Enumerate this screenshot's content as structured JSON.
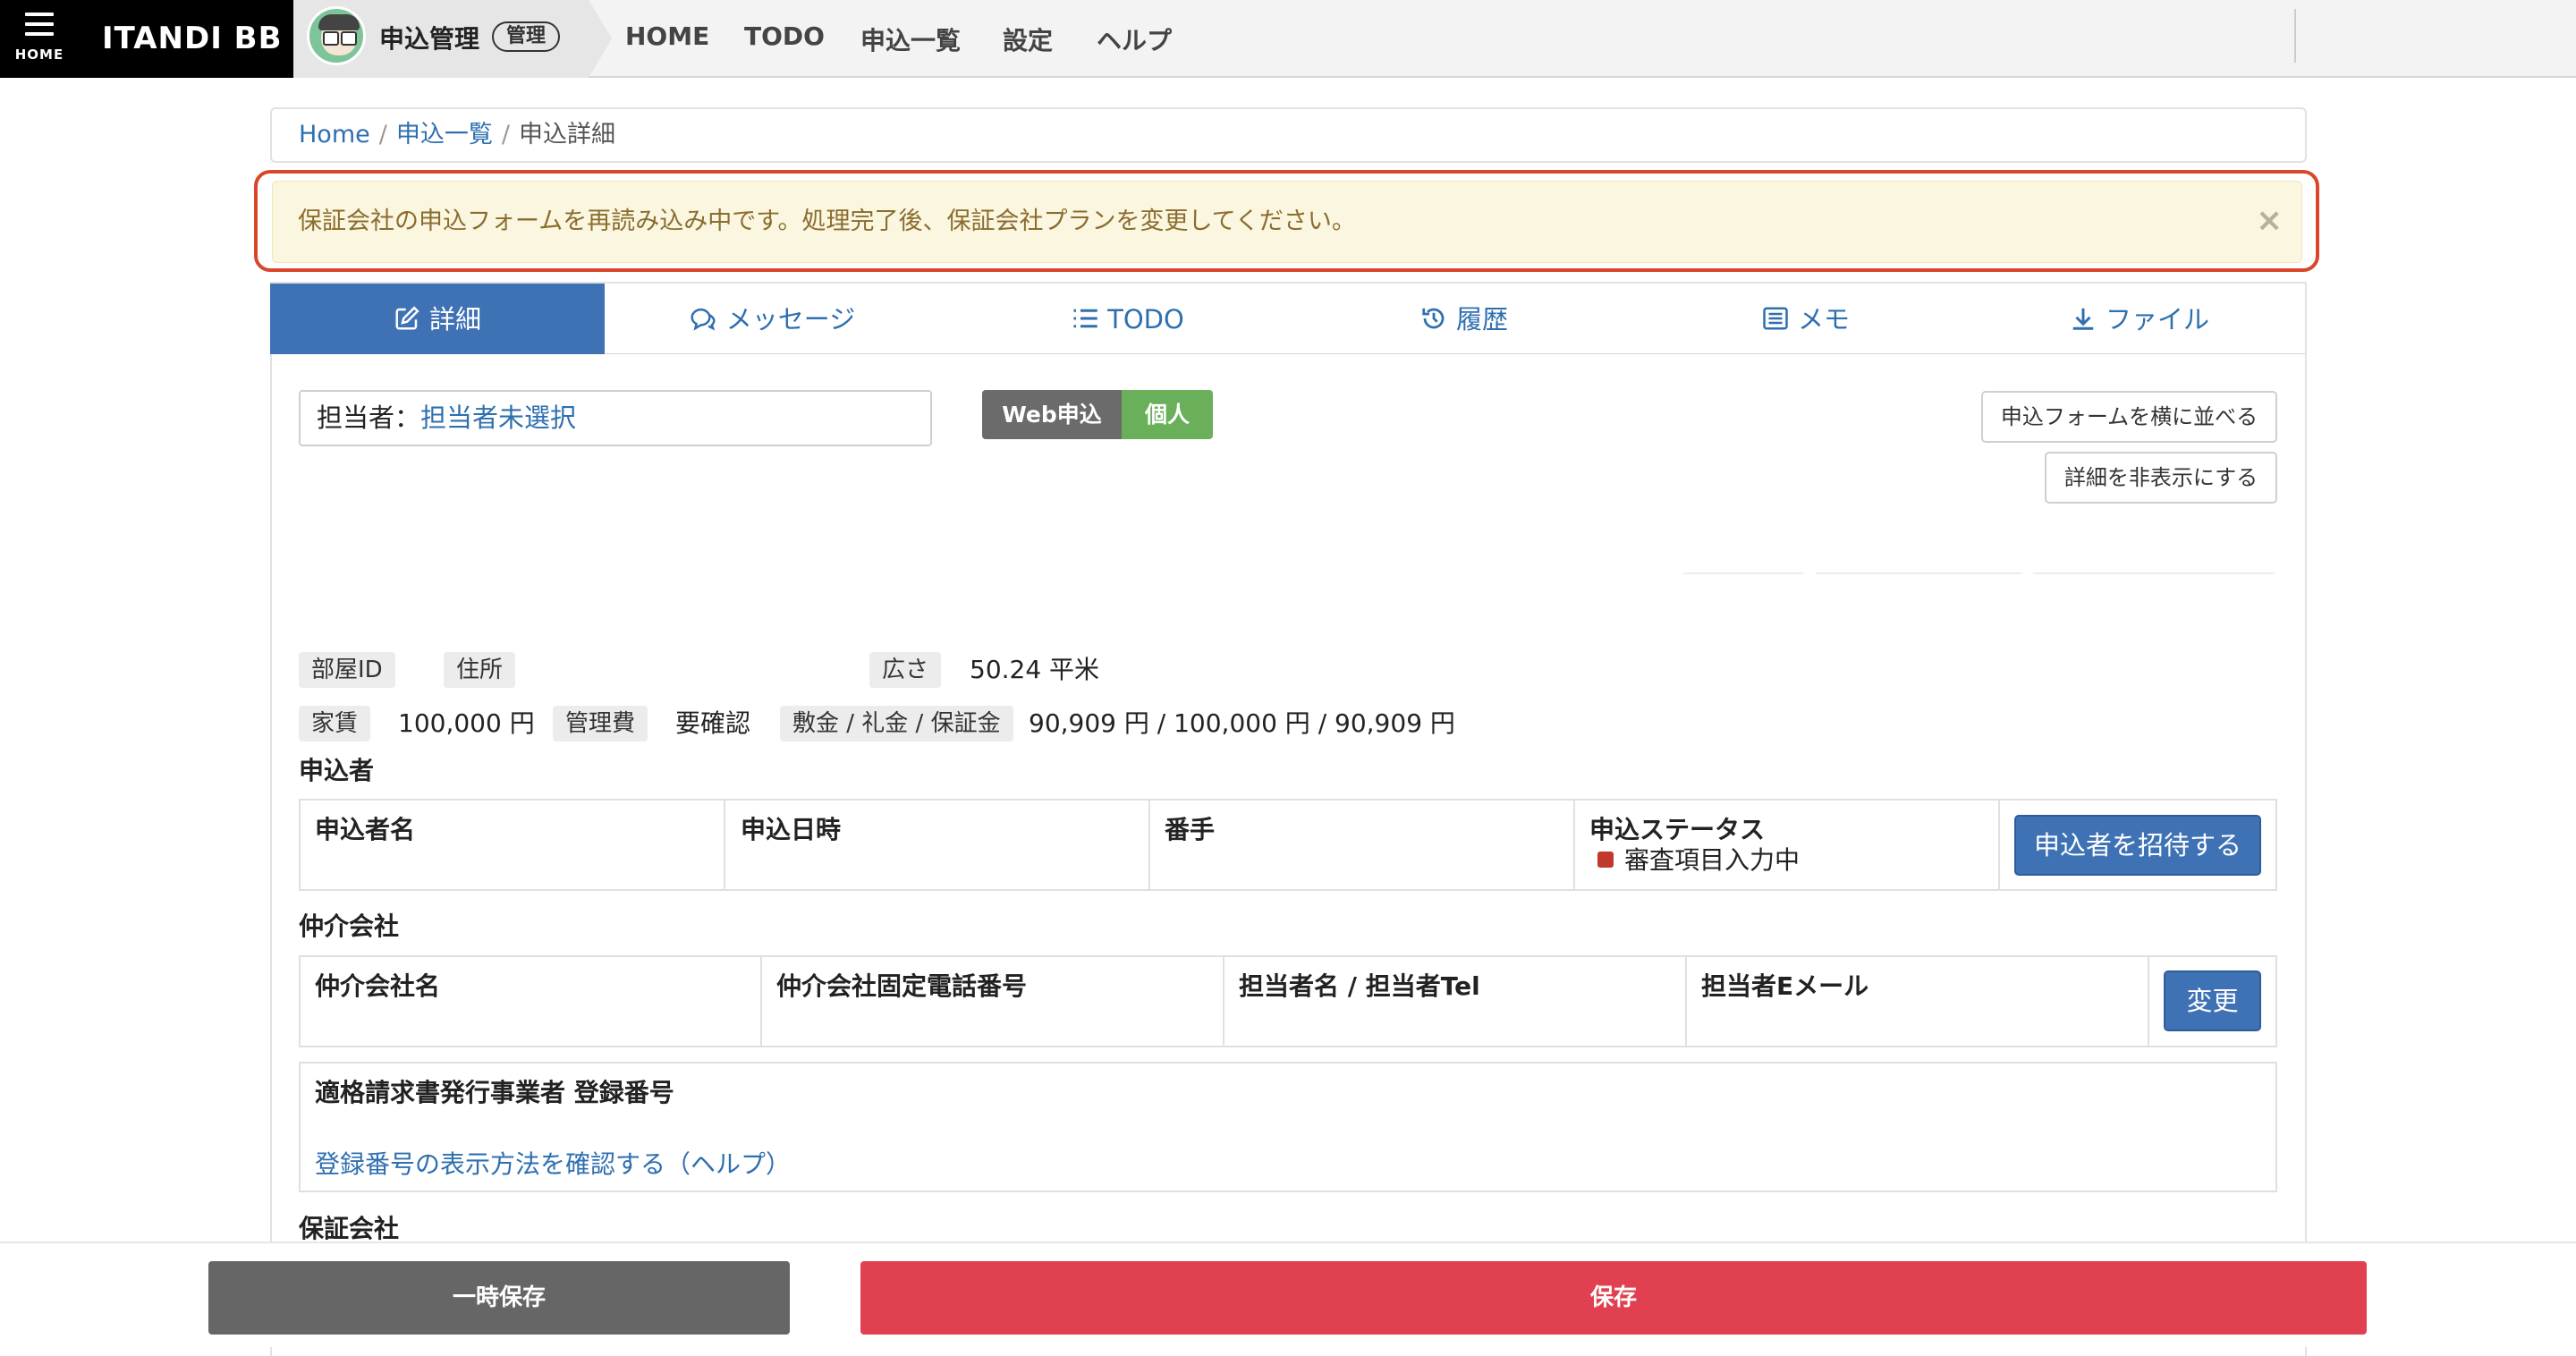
{
  "topbar": {
    "home_label": "HOME",
    "logo": "ITANDI BB",
    "app_title": "申込管理",
    "app_badge": "管理",
    "nav": [
      "HOME",
      "TODO",
      "申込一覧",
      "設定",
      "ヘルプ"
    ]
  },
  "breadcrumb": {
    "home": "Home",
    "list": "申込一覧",
    "current": "申込詳細",
    "separator": "/"
  },
  "alert": {
    "message": "保証会社の申込フォームを再読み込み中です。処理完了後、保証会社プランを変更してください。",
    "close": "×"
  },
  "tabs": [
    "詳細",
    "メッセージ",
    "TODO",
    "履歴",
    "メモ",
    "ファイル"
  ],
  "detail": {
    "assignee_label": "担当者：",
    "assignee_value": "担当者未選択",
    "tag_web": "Web申込",
    "tag_type": "個人",
    "side_by_side_button": "申込フォームを横に並べる",
    "hide_details_button": "詳細を非表示にする",
    "room_id_label": "部屋ID",
    "address_label": "住所",
    "area_label": "広さ",
    "area_value": "50.24 平米",
    "rent_label": "家賃",
    "rent_value": "100,000 円",
    "fee_label": "管理費",
    "fee_value": "要確認",
    "deposit_label": "敷金 / 礼金 / 保証金",
    "deposit_value": "90,909 円 / 100,000 円 / 90,909 円"
  },
  "applicant": {
    "heading": "申込者",
    "columns": [
      "申込者名",
      "申込日時",
      "番手",
      "申込ステータス"
    ],
    "status_value": "審査項目入力中",
    "invite_button": "申込者を招待する",
    "status_color": "#c0392b"
  },
  "broker": {
    "heading": "仲介会社",
    "columns": [
      "仲介会社名",
      "仲介会社固定電話番号",
      "担当者名 / 担当者Tel",
      "担当者Eメール"
    ],
    "change_button": "変更",
    "invoice_label": "適格請求書発行事業者 登録番号",
    "invoice_help_link": "登録番号の表示方法を確認する（ヘルプ）"
  },
  "guarantor": {
    "heading": "保証会社"
  },
  "footer": {
    "temp_save": "一時保存",
    "save": "保存"
  },
  "colors": {
    "accent": "#3f72b5",
    "danger": "#e0404f",
    "web_tag": "#6b6b6b",
    "individual_tag": "#6ab05b",
    "alert_bg": "#fbf6e0",
    "alert_border": "#d9472b"
  }
}
